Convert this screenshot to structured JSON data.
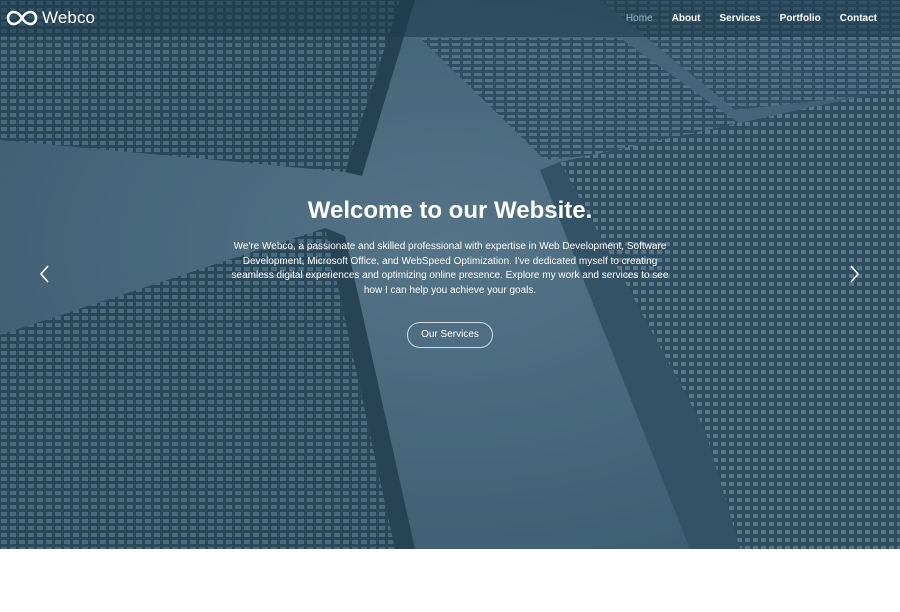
{
  "brand": {
    "name": "Webco",
    "logo_icon": "infinity-icon"
  },
  "nav": {
    "items": [
      {
        "label": "Home",
        "active": true
      },
      {
        "label": "About",
        "active": false
      },
      {
        "label": "Services",
        "active": false
      },
      {
        "label": "Portfolio",
        "active": false
      },
      {
        "label": "Contact",
        "active": false
      }
    ]
  },
  "hero": {
    "title": "Welcome to our Website.",
    "description": "We're Webco, a passionate and skilled professional with expertise in Web Development, Software Development, Microsoft Office, and WebSpeed Optimization. I've dedicated myself to creating seamless digital experiences and optimizing online presence. Explore my work and services to see how I can help you achieve your goals.",
    "cta_label": "Our Services",
    "prev_icon": "chevron-left-icon",
    "next_icon": "chevron-right-icon"
  },
  "colors": {
    "overlay": "#3f5f73",
    "navbar": "#1e3a4c",
    "active_nav": "#9fb9c8",
    "text": "#ffffff"
  }
}
